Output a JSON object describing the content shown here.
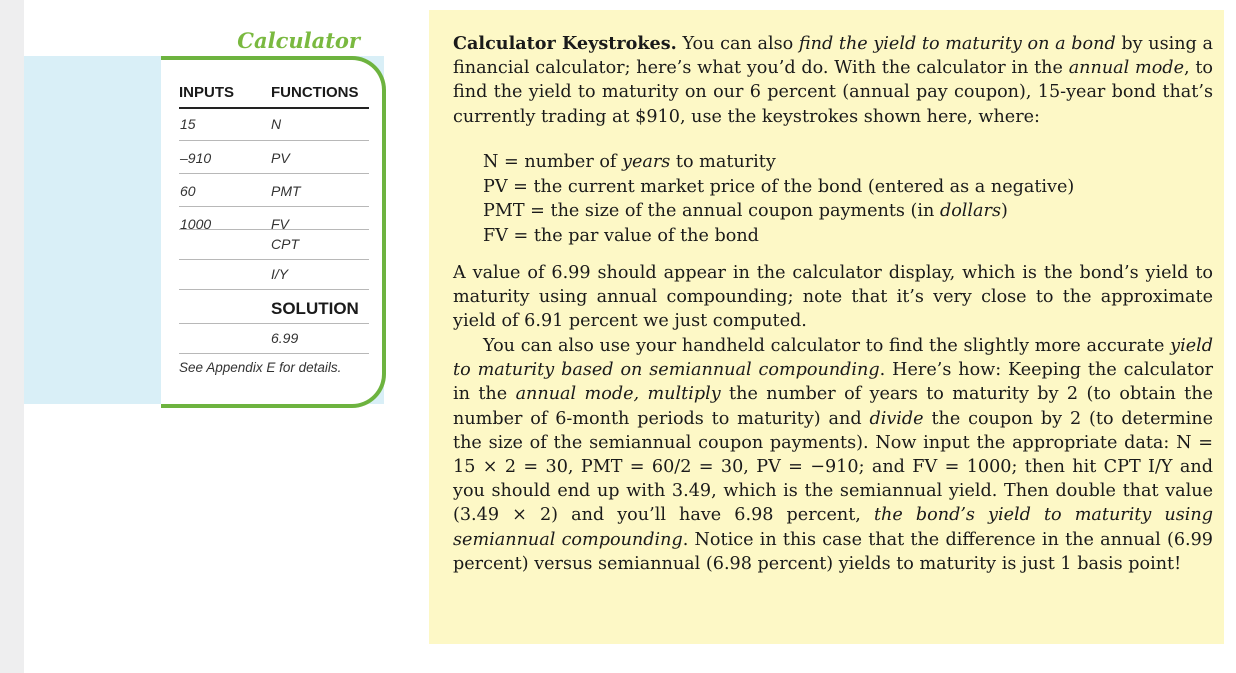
{
  "calculator": {
    "title": "Calculator",
    "inputs_header": "INPUTS",
    "functions_header": "FUNCTIONS",
    "rows": [
      {
        "input": "15",
        "function": "N"
      },
      {
        "input": "–910",
        "function": "PV"
      },
      {
        "input": "60",
        "function": "PMT"
      },
      {
        "input": "1000",
        "function": "FV"
      },
      {
        "input": "",
        "function": "CPT"
      },
      {
        "input": "",
        "function": "I/Y"
      }
    ],
    "solution_header": "SOLUTION",
    "solution_value": "6.99",
    "appendix_note": "See Appendix E for details.",
    "colors": {
      "accent": "#6db33f",
      "panel_bg": "#d9eff7"
    }
  },
  "text": {
    "heading": "Calculator Keystrokes.",
    "p1": [
      {
        "t": " You can also "
      },
      {
        "t": "find the yield to maturity on a bond",
        "i": true
      },
      {
        "t": " by using a financial calculator; here’s what you’d do. With the calculator in the "
      },
      {
        "t": "annual mode",
        "i": true
      },
      {
        "t": ", to find the yield to maturity on our 6 percent (annual pay coupon), 15-year bond that’s currently trading at $910, use the keystrokes shown here, where:"
      }
    ],
    "definitions": [
      [
        {
          "t": "N = number of "
        },
        {
          "t": "years",
          "i": true
        },
        {
          "t": " to maturity"
        }
      ],
      [
        {
          "t": "PV = the current market price of the bond (entered as a negative)"
        }
      ],
      [
        {
          "t": "PMT = the size of the annual coupon payments (in "
        },
        {
          "t": "dollars",
          "i": true
        },
        {
          "t": ")"
        }
      ],
      [
        {
          "t": "FV = the par value of the bond"
        }
      ]
    ],
    "p2": [
      {
        "t": "A value of 6.99 should appear in the calculator display, which is the bond’s yield to maturity using annual compounding; note that it’s very close to the approximate yield of 6.91 percent we just computed."
      }
    ],
    "p3": [
      {
        "t": "You can also use your handheld calculator to find the slightly more accurate "
      },
      {
        "t": "yield to maturity based on semiannual compounding",
        "i": true
      },
      {
        "t": ". Here’s how: Keeping the calculator in the "
      },
      {
        "t": "annual mode, multiply",
        "i": true
      },
      {
        "t": " the number of years to maturity by 2 (to obtain the number of 6-month periods to maturity) and "
      },
      {
        "t": "divide",
        "i": true
      },
      {
        "t": " the coupon by 2 (to determine the size of the semiannual coupon payments). Now input the appropriate data: N = 15 × 2 = 30, PMT = 60/2 = 30, PV = −910; and FV = 1000; then hit CPT I/Y and you should end up with 3.49, which is the semiannual yield. Then double that value (3.49 × 2) and you’ll have 6.98 percent, "
      },
      {
        "t": "the bond’s yield to maturity using semiannual compounding",
        "i": true
      },
      {
        "t": ". Notice in this case that the difference in the annual (6.99 percent) versus semiannual (6.98 percent) yields to maturity is just 1 basis point!"
      }
    ],
    "colors": {
      "box_bg": "#fdf8c6"
    }
  }
}
